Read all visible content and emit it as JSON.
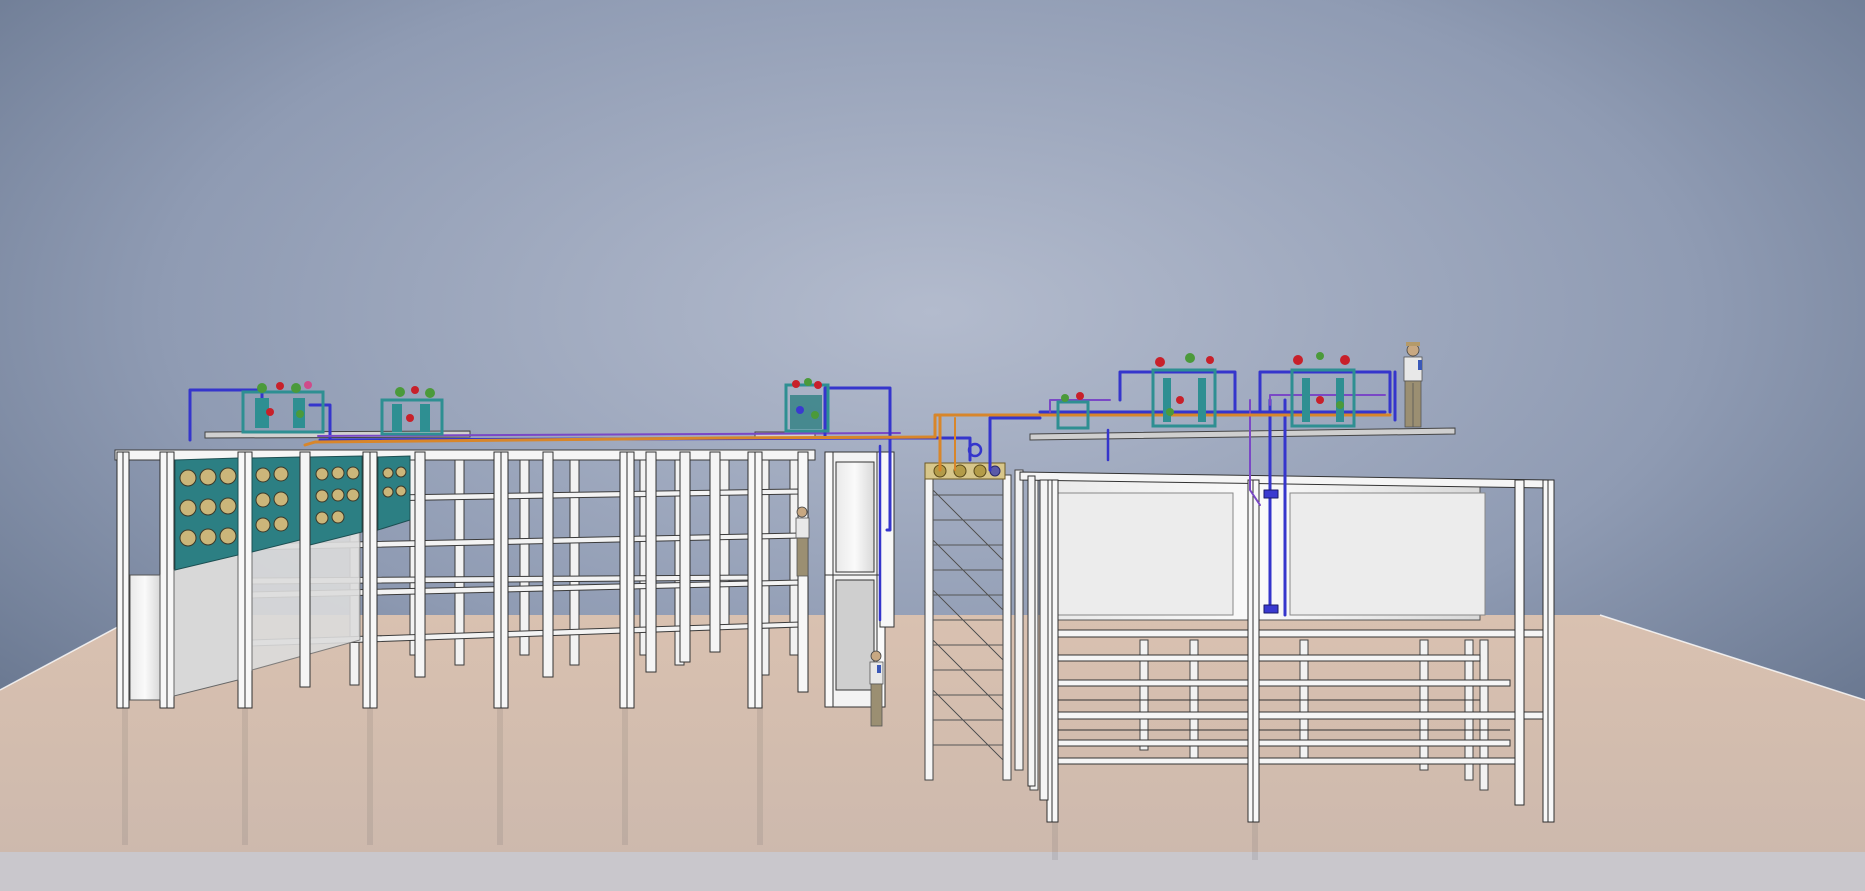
{
  "scene": {
    "description_visible_text": "",
    "colors": {
      "sky_top": "#6f7f9a",
      "sky_mid": "#a7b0c3",
      "sky_bottom": "#c9cdd6",
      "floor": "#d7bfae",
      "floor_near": "#c9b8ad",
      "frame_white": "#f4f4f4",
      "frame_edge": "#3b3b3b",
      "pipe_blue": "#3a3ad0",
      "pipe_orange": "#d98a2b",
      "pipe_purple": "#8a4ac0",
      "equipment_teal": "#2e8f92",
      "panel_green": "#4b7a73",
      "valve_red": "#c8202a",
      "valve_green": "#4b9a3a",
      "coil_gold": "#b9a24a",
      "worker_shirt": "#e8e8e8",
      "worker_pants": "#9b8f72"
    },
    "icons": [
      "worker-figure",
      "valve-assembly",
      "pump-skid",
      "fan-coil-panel"
    ]
  }
}
